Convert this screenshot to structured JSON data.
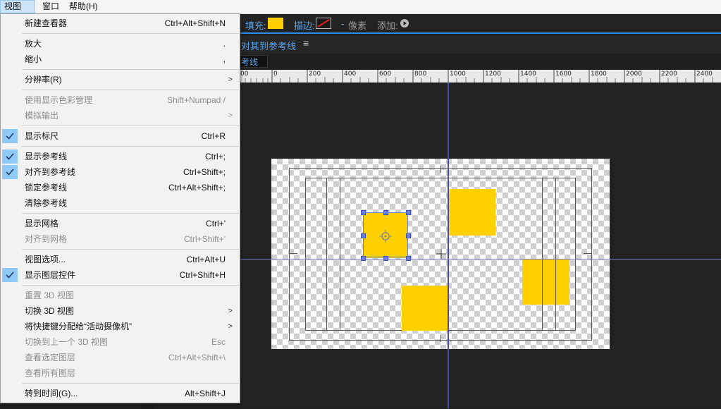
{
  "menubar": {
    "items": [
      {
        "label": "视图(V)",
        "active": true
      },
      {
        "label": "窗口",
        "active": false
      },
      {
        "label": "帮助(H)",
        "active": false
      }
    ]
  },
  "toolbar": {
    "fill_label": "填充:",
    "fill_color": "#ffd000",
    "stroke_label": "描边:",
    "stroke_separator": "-",
    "pixels_label": "像素",
    "add_label": "添加:"
  },
  "panel": {
    "align_label": "对其到参考线",
    "sub_label": "考线"
  },
  "ruler": {
    "labels": [
      "00",
      "0",
      "200",
      "400",
      "600",
      "800",
      "1000",
      "1200",
      "1400",
      "1600",
      "1800",
      "2000",
      "2200",
      "2400"
    ]
  },
  "menu": {
    "items": [
      {
        "label": "新建查看器",
        "shortcut": "Ctrl+Alt+Shift+N"
      },
      {
        "label": "放大",
        "shortcut": "."
      },
      {
        "label": "缩小",
        "shortcut": ","
      },
      {
        "label": "分辨率(R)",
        "shortcut": ""
      },
      {
        "label": "使用显示色彩管理",
        "shortcut": "Shift+Numpad /"
      },
      {
        "label": "模拟输出",
        "shortcut": ""
      },
      {
        "label": "显示标尺",
        "shortcut": "Ctrl+R"
      },
      {
        "label": "显示参考线",
        "shortcut": "Ctrl+;"
      },
      {
        "label": "对齐到参考线",
        "shortcut": "Ctrl+Shift+;"
      },
      {
        "label": "锁定参考线",
        "shortcut": "Ctrl+Alt+Shift+;"
      },
      {
        "label": "清除参考线",
        "shortcut": ""
      },
      {
        "label": "显示网格",
        "shortcut": "Ctrl+'"
      },
      {
        "label": "对齐到网格",
        "shortcut": "Ctrl+Shift+'"
      },
      {
        "label": "视图选项...",
        "shortcut": "Ctrl+Alt+U"
      },
      {
        "label": "显示图层控件",
        "shortcut": "Ctrl+Shift+H"
      },
      {
        "label": "重置 3D 视图",
        "shortcut": ""
      },
      {
        "label": "切换 3D 视图",
        "shortcut": ""
      },
      {
        "label": "将快捷键分配给“活动摄像机”",
        "shortcut": ""
      },
      {
        "label": "切换到上一个 3D 视图",
        "shortcut": "Esc"
      },
      {
        "label": "查看选定图层",
        "shortcut": "Ctrl+Alt+Shift+\\"
      },
      {
        "label": "查看所有图层",
        "shortcut": ""
      },
      {
        "label": "转到时间(G)...",
        "shortcut": "Alt+Shift+J"
      }
    ]
  },
  "colors": {
    "accent": "#2d8ceb",
    "check_bg": "#90c8f6",
    "layer_fill": "#ffd000",
    "guide": "#4a4aa8"
  }
}
